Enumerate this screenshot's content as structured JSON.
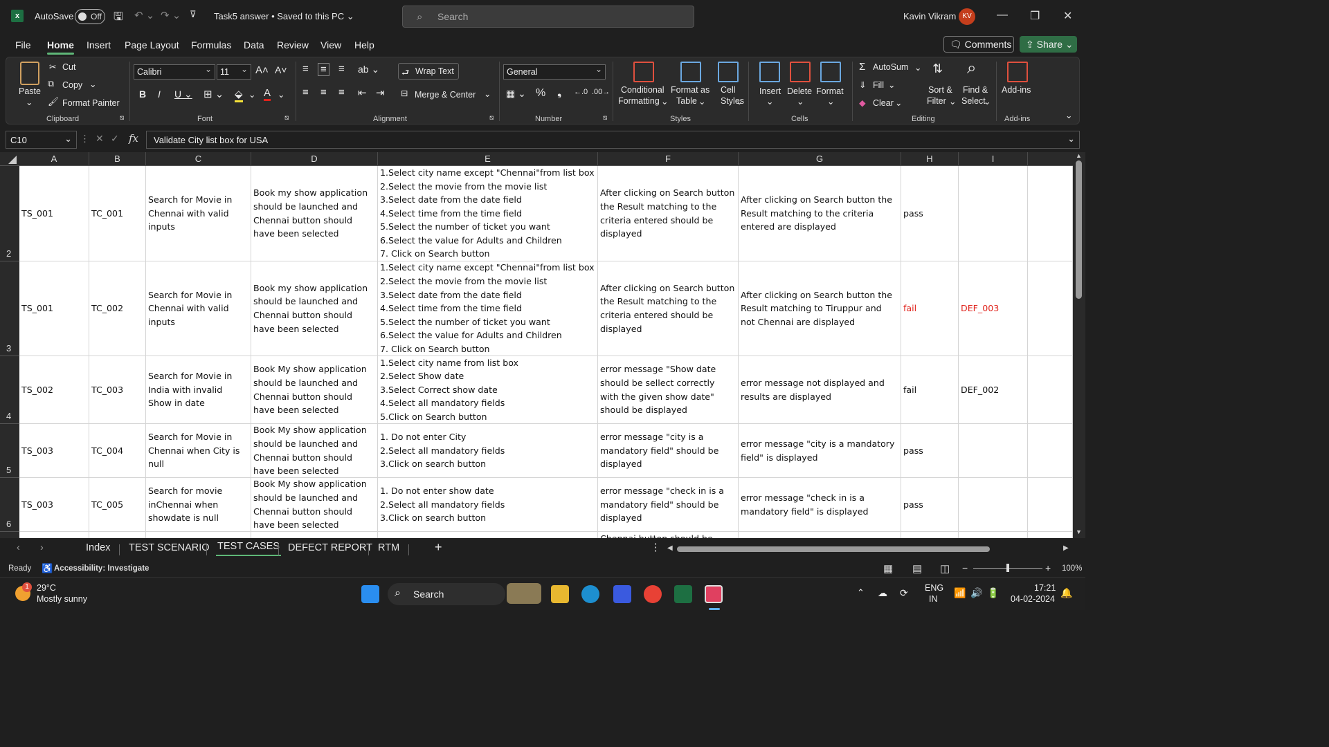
{
  "titlebar": {
    "autosave_label": "AutoSave",
    "autosave_state": "Off",
    "doc_title": "Task5 answer • Saved to this PC ⌄",
    "search_placeholder": "Search",
    "user_name": "Kavin Vikram",
    "user_initials": "KV"
  },
  "menu": {
    "items": [
      "File",
      "Home",
      "Insert",
      "Page Layout",
      "Formulas",
      "Data",
      "Review",
      "View",
      "Help"
    ],
    "comments_label": "Comments",
    "share_label": "Share"
  },
  "ribbon": {
    "clipboard": {
      "paste": "Paste",
      "cut": "Cut",
      "copy": "Copy",
      "format_painter": "Format Painter",
      "label": "Clipboard"
    },
    "font": {
      "name": "Calibri",
      "size": "11",
      "label": "Font"
    },
    "alignment": {
      "wrap_text": "Wrap Text",
      "merge_center": "Merge & Center",
      "label": "Alignment"
    },
    "number": {
      "format": "General",
      "label": "Number"
    },
    "styles": {
      "conditional_1": "Conditional",
      "conditional_2": "Formatting",
      "format_table_1": "Format as",
      "format_table_2": "Table",
      "cell_styles_1": "Cell",
      "cell_styles_2": "Styles",
      "label": "Styles"
    },
    "cells": {
      "insert": "Insert",
      "delete": "Delete",
      "format": "Format",
      "label": "Cells"
    },
    "editing": {
      "autosum": "AutoSum",
      "fill": "Fill",
      "clear": "Clear",
      "sort_1": "Sort &",
      "sort_2": "Filter",
      "find_1": "Find &",
      "find_2": "Select",
      "label": "Editing"
    },
    "addins": {
      "addins": "Add-ins",
      "label": "Add-ins"
    }
  },
  "formula_bar": {
    "name_box": "C10",
    "formula": "Validate City list box for USA"
  },
  "columns": [
    "A",
    "B",
    "C",
    "D",
    "E",
    "F",
    "G",
    "H",
    "I"
  ],
  "rows": [
    {
      "num": "2",
      "cells": [
        "TS_001",
        "TC_001",
        "Search for Movie in Chennai with valid inputs",
        "Book my show application should be launched and Chennai button should have been selected",
        "1.Select city name except \"Chennai\"from list box\n2.Select the movie from the movie list\n3.Select date from the date field\n4.Select time from the time field\n5.Select the number of ticket you want\n6.Select the value for Adults and Children\n7. Click on Search button",
        "After clicking on Search button the Result matching to the criteria entered should be displayed",
        "After clicking on Search button the Result matching to the criteria entered are displayed",
        "pass",
        ""
      ],
      "red": false
    },
    {
      "num": "3",
      "cells": [
        "TS_001",
        "TC_002",
        "Search for Movie in Chennai with valid inputs",
        "Book my show application should be launched and Chennai button should have been selected",
        "1.Select city name except \"Chennai\"from list box\n2.Select the movie from the movie list\n3.Select date from the date field\n4.Select time from the time field\n5.Select the number of ticket you want\n6.Select the value for Adults and Children\n7. Click on Search button",
        "After clicking on Search button the Result matching to the criteria entered should be displayed",
        "After clicking on Search button the Result matching to Tiruppur and not Chennai are displayed",
        "fail",
        "DEF_003"
      ],
      "red": true
    },
    {
      "num": "4",
      "cells": [
        "TS_002",
        "TC_003",
        "Search for Movie in India with invalid Show in date",
        "Book My show application should be launched and Chennai button should have been selected",
        "1.Select city name from list box\n2.Select Show date\n3.Select Correct show date\n4.Select all mandatory fields\n5.Click on Search button",
        "error message \"Show  date should be sellect correctly with the given show date\" should be displayed",
        "error message not displayed and results are displayed",
        "fail",
        "DEF_002"
      ],
      "red": false
    },
    {
      "num": "5",
      "cells": [
        "TS_003",
        "TC_004",
        "Search for Movie in Chennai when City is null",
        "Book My show application should be launched and Chennai button should have been selected",
        "1. Do not enter City\n2.Select all mandatory fields\n3.Click on search button",
        "error message \"city is a mandatory field\" should be displayed",
        "error message \"city is a mandatory field\" is displayed",
        "pass",
        ""
      ],
      "red": false
    },
    {
      "num": "6",
      "cells": [
        "TS_003",
        "TC_005",
        "Search for movie inChennai when showdate is null",
        "Book My show application should be launched and Chennai button should have been selected",
        "1. Do not enter show date\n2.Select all mandatory fields\n3.Click on search button",
        "error message \"check in is a mandatory field\" should be displayed",
        "error message \"check in is a mandatory field\" is displayed",
        "pass",
        ""
      ],
      "red": false
    },
    {
      "num": "",
      "cells": [
        "",
        "",
        "",
        "",
        "",
        "Chennai button should be",
        "",
        "",
        ""
      ],
      "red": false
    }
  ],
  "sheet_tabs": [
    "Index",
    "TEST SCENARIO",
    "TEST CASES",
    "DEFECT REPORT",
    "RTM"
  ],
  "active_tab": "TEST CASES",
  "status": {
    "ready": "Ready",
    "accessibility": "Accessibility: Investigate",
    "zoom": "100%"
  },
  "taskbar": {
    "temp": "29°C",
    "weather": "Mostly sunny",
    "weather_badge": "1",
    "search": "Search",
    "lang_1": "ENG",
    "lang_2": "IN",
    "time": "17:21",
    "date": "04-02-2024"
  },
  "colors": {
    "excel_green": "#1d6f42",
    "accent_green": "#5fb878",
    "fail_red": "#e0231c"
  }
}
